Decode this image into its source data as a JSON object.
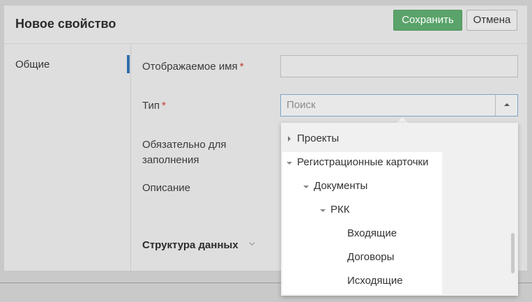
{
  "dialog": {
    "title": "Новое свойство",
    "save_label": "Сохранить",
    "cancel_label": "Отмена"
  },
  "nav": {
    "items": [
      {
        "label": "Общие"
      }
    ]
  },
  "form": {
    "display_name_label": "Отображаемое имя",
    "type_label": "Тип",
    "required_label": "Обязательно для заполнения",
    "description_label": "Описание",
    "required_marker": "*",
    "type_placeholder": "Поиск",
    "display_name_value": ""
  },
  "data_structure": {
    "title": "Структура данных"
  },
  "dropdown": {
    "items": [
      {
        "label": "Проекты",
        "expanded": false
      },
      {
        "label": "Регистрационные карточки",
        "expanded": true
      },
      {
        "label": "Документы",
        "expanded": true
      },
      {
        "label": "РКК",
        "expanded": true
      },
      {
        "label": "Входящие"
      },
      {
        "label": "Договоры"
      },
      {
        "label": "Исходящие"
      }
    ]
  },
  "colors": {
    "accent": "#2f6eab",
    "save_button": "#5aa36a",
    "required": "#c0392b"
  }
}
